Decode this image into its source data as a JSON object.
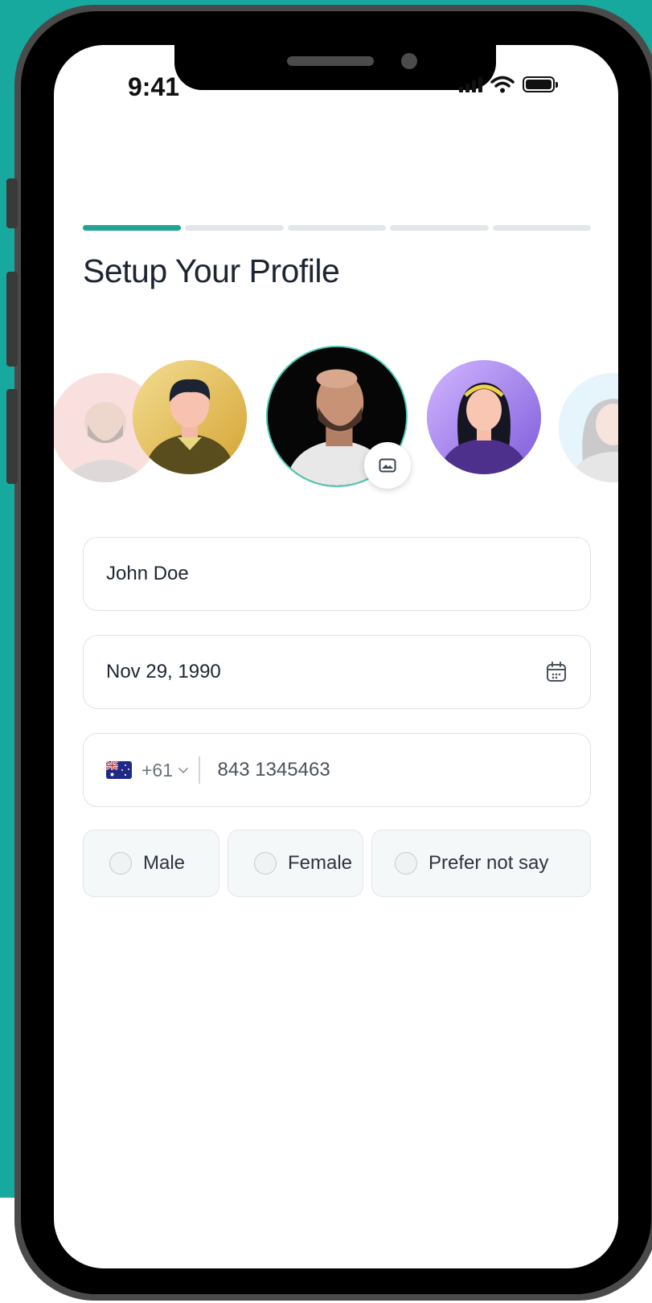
{
  "status_bar": {
    "time": "9:41"
  },
  "profile": {
    "title": "Setup Your Profile",
    "progress_steps": 5,
    "progress_current": 1
  },
  "avatars": [
    {
      "name": "avatar-bearded-man",
      "selected": false
    },
    {
      "name": "avatar-man-hoodie",
      "selected": false
    },
    {
      "name": "avatar-photo-man",
      "selected": true
    },
    {
      "name": "avatar-woman-purple",
      "selected": false
    },
    {
      "name": "avatar-woman-blue",
      "selected": false
    }
  ],
  "form": {
    "full_name": "John Doe",
    "birth_date": "Nov 29, 1990",
    "phone": {
      "flag": "AU",
      "dial_code": "+61",
      "number": "843 1345463"
    },
    "gender_options": [
      "Male",
      "Female",
      "Prefer not say"
    ]
  },
  "icons": {
    "photo": "image-icon",
    "calendar": "calendar-icon",
    "chevron": "chevron-down-icon"
  },
  "colors": {
    "accent": "#21a494",
    "background": "#17a99d"
  }
}
